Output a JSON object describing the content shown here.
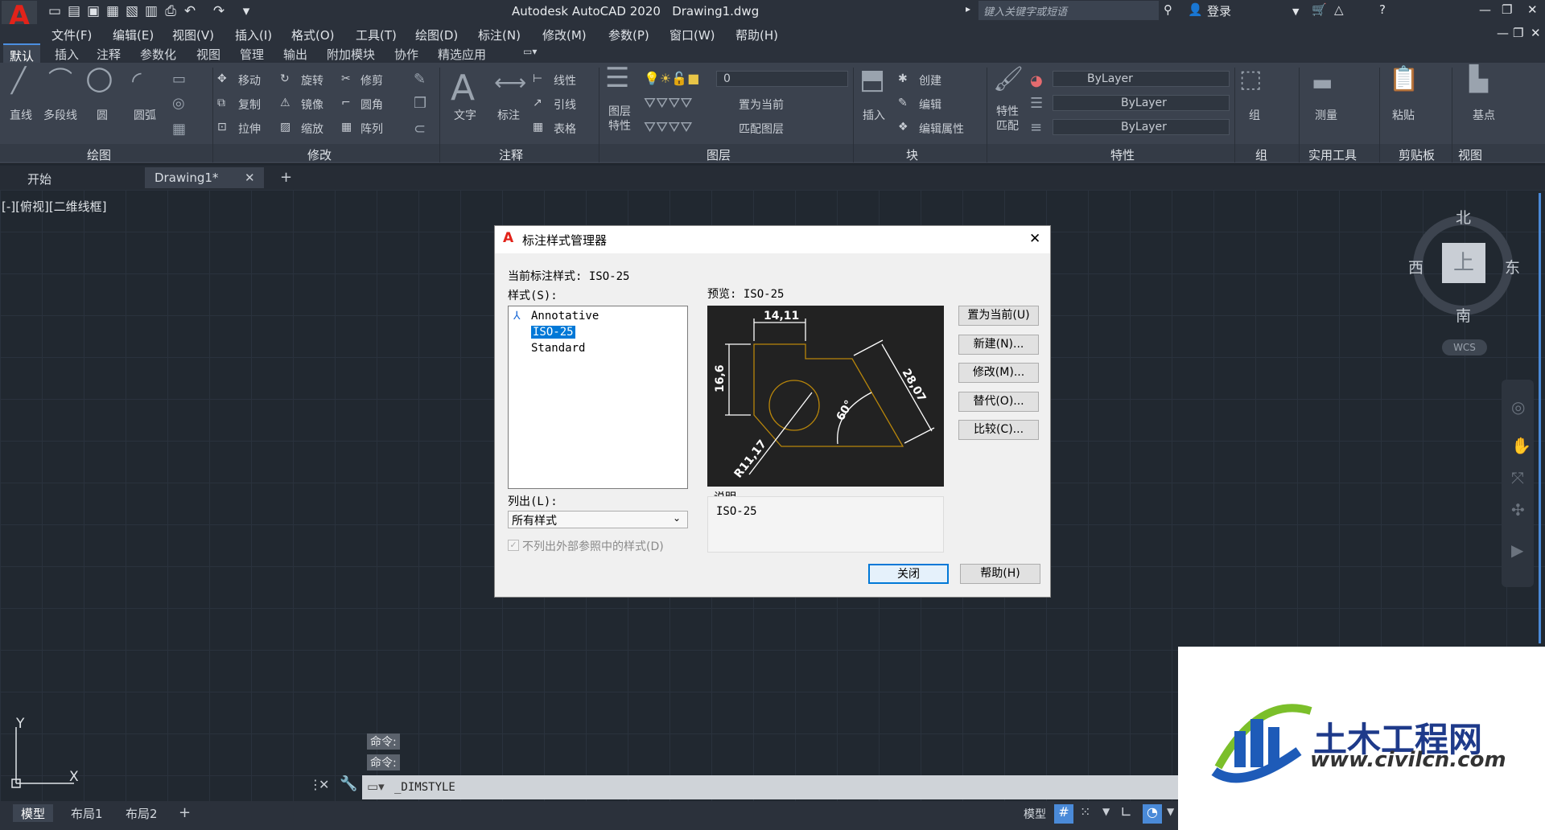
{
  "app": {
    "title": "Autodesk AutoCAD 2020",
    "document": "Drawing1.dwg",
    "logo_letter": "A"
  },
  "search": {
    "placeholder": "键入关键字或短语"
  },
  "account": {
    "login": "登录"
  },
  "menus": [
    "文件(F)",
    "编辑(E)",
    "视图(V)",
    "插入(I)",
    "格式(O)",
    "工具(T)",
    "绘图(D)",
    "标注(N)",
    "修改(M)",
    "参数(P)",
    "窗口(W)",
    "帮助(H)"
  ],
  "ribbon_tabs": [
    "默认",
    "插入",
    "注释",
    "参数化",
    "视图",
    "管理",
    "输出",
    "附加模块",
    "协作",
    "精选应用"
  ],
  "ribbon": {
    "draw": {
      "title": "绘图",
      "tools": [
        "直线",
        "多段线",
        "圆",
        "圆弧"
      ]
    },
    "modify": {
      "title": "修改",
      "tools": [
        "移动",
        "旋转",
        "修剪",
        "复制",
        "镜像",
        "圆角",
        "拉伸",
        "缩放",
        "阵列"
      ]
    },
    "annotation": {
      "title": "注释",
      "tools": [
        "文字",
        "标注",
        "线性",
        "引线",
        "表格"
      ]
    },
    "layers": {
      "title": "图层",
      "layer_props": "图层\n特性",
      "current_layer": "0",
      "tools": [
        "置为当前",
        "匹配图层"
      ]
    },
    "block": {
      "title": "块",
      "insert": "插入",
      "tools": [
        "创建",
        "编辑",
        "编辑属性"
      ]
    },
    "properties": {
      "title": "特性",
      "match": "特性\n匹配",
      "color": "ByLayer",
      "linetype": "ByLayer",
      "lineweight": "ByLayer"
    },
    "groups": {
      "title": "组",
      "label": "组"
    },
    "utilities": {
      "title": "实用工具",
      "measure": "测量"
    },
    "clipboard": {
      "title": "剪贴板",
      "paste": "粘贴"
    },
    "view": {
      "title": "视图",
      "base": "基点"
    }
  },
  "file_tabs": {
    "start": "开始",
    "drawing": "Drawing1*"
  },
  "viewport": {
    "label": "[-][俯视][二维线框]"
  },
  "viewcube": {
    "north": "北",
    "south": "南",
    "east": "东",
    "west": "西",
    "top": "上",
    "wcs": "WCS"
  },
  "ucs": {
    "x": "X",
    "y": "Y"
  },
  "dialog": {
    "title": "标注样式管理器",
    "current_style_label": "当前标注样式: ISO-25",
    "styles_label": "样式(S):",
    "styles": [
      "Annotative",
      "ISO-25",
      "Standard"
    ],
    "selected_style": "ISO-25",
    "preview_label": "预览: ISO-25",
    "preview_dims": {
      "top": "14,11",
      "left": "16,6",
      "right": "28,07",
      "angle": "60°",
      "radius": "R11,17"
    },
    "buttons": [
      "置为当前(U)",
      "新建(N)...",
      "修改(M)...",
      "替代(O)...",
      "比较(C)..."
    ],
    "list_label": "列出(L):",
    "list_value": "所有样式",
    "checkbox": "不列出外部参照中的样式(D)",
    "desc_label": "说明",
    "desc_value": "ISO-25",
    "close": "关闭",
    "help": "帮助(H)"
  },
  "command": {
    "history": [
      "命令:",
      "命令:"
    ],
    "current": "_DIMSTYLE"
  },
  "layout_tabs": [
    "模型",
    "布局1",
    "布局2"
  ],
  "status": {
    "model": "模型"
  },
  "watermark": {
    "cn": "土木工程网",
    "url": "www.civilcn.com"
  }
}
